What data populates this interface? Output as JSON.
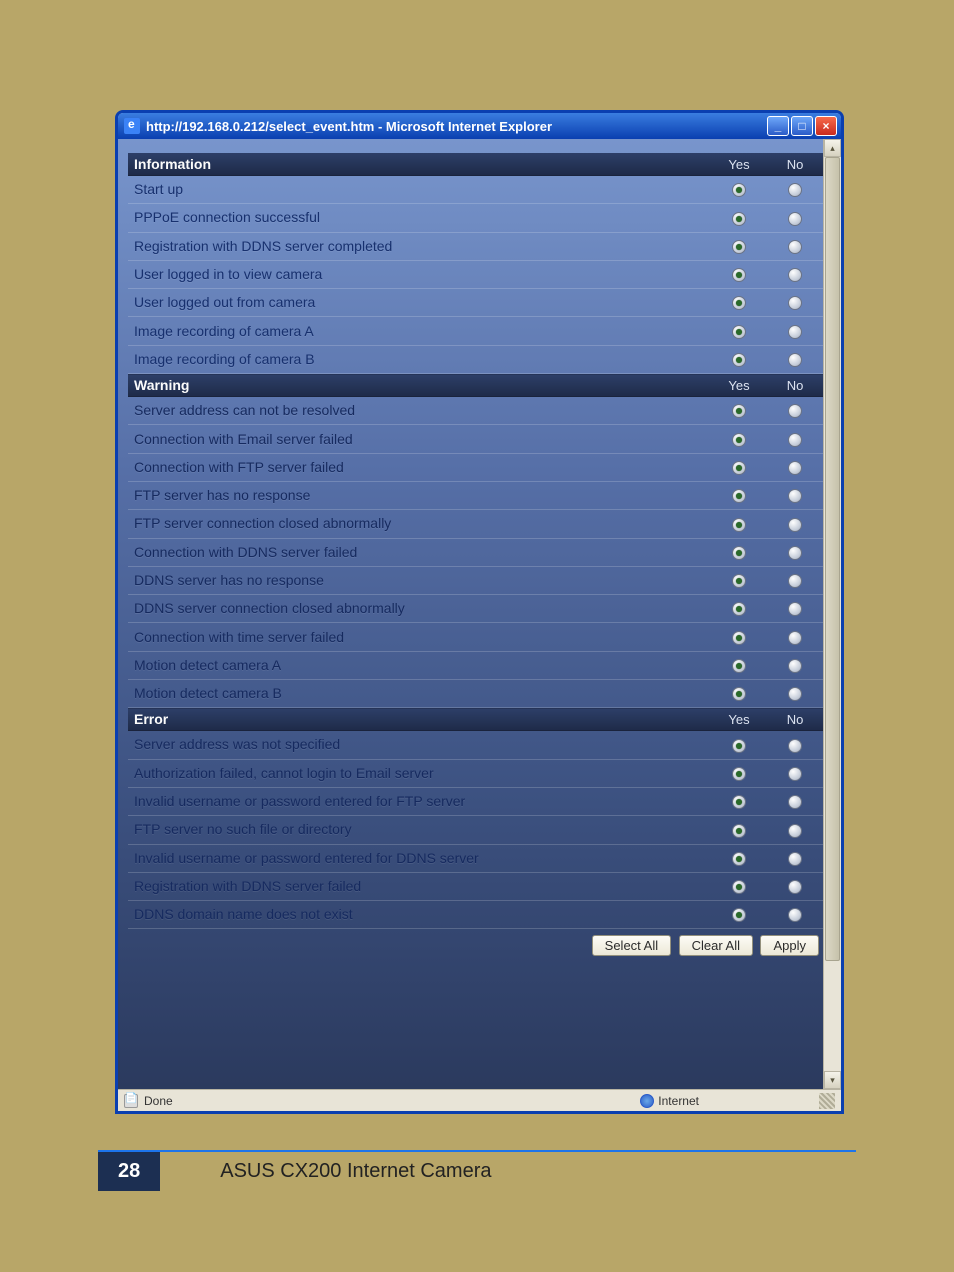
{
  "window": {
    "title": "http://192.168.0.212/select_event.htm - Microsoft Internet Explorer"
  },
  "columns": {
    "yes": "Yes",
    "no": "No"
  },
  "sections": [
    {
      "title": "Information",
      "rows": [
        {
          "label": "Start up",
          "selected": "yes"
        },
        {
          "label": "PPPoE connection successful",
          "selected": "yes"
        },
        {
          "label": "Registration with DDNS server completed",
          "selected": "yes"
        },
        {
          "label": "User logged in to view camera",
          "selected": "yes"
        },
        {
          "label": "User logged out from camera",
          "selected": "yes"
        },
        {
          "label": "Image recording of camera A",
          "selected": "yes"
        },
        {
          "label": "Image recording of camera B",
          "selected": "yes"
        }
      ]
    },
    {
      "title": "Warning",
      "rows": [
        {
          "label": "Server address can not be resolved",
          "selected": "yes"
        },
        {
          "label": "Connection with Email server failed",
          "selected": "yes"
        },
        {
          "label": "Connection with FTP server failed",
          "selected": "yes"
        },
        {
          "label": "FTP server has no response",
          "selected": "yes"
        },
        {
          "label": "FTP server connection closed abnormally",
          "selected": "yes"
        },
        {
          "label": "Connection with DDNS server failed",
          "selected": "yes"
        },
        {
          "label": "DDNS server has no response",
          "selected": "yes"
        },
        {
          "label": "DDNS server connection closed abnormally",
          "selected": "yes"
        },
        {
          "label": "Connection with time server failed",
          "selected": "yes"
        },
        {
          "label": "Motion detect camera A",
          "selected": "yes"
        },
        {
          "label": "Motion detect camera B",
          "selected": "yes"
        }
      ]
    },
    {
      "title": "Error",
      "rows": [
        {
          "label": "Server address was not specified",
          "selected": "yes"
        },
        {
          "label": "Authorization failed, cannot login to Email server",
          "selected": "yes"
        },
        {
          "label": "Invalid username or password entered for FTP server",
          "selected": "yes"
        },
        {
          "label": "FTP server no such file or directory",
          "selected": "yes"
        },
        {
          "label": "Invalid username or password entered for DDNS server",
          "selected": "yes"
        },
        {
          "label": "Registration with DDNS server failed",
          "selected": "yes"
        },
        {
          "label": "DDNS domain name does not exist",
          "selected": "yes"
        }
      ]
    }
  ],
  "buttons": {
    "select_all": "Select All",
    "clear_all": "Clear All",
    "apply": "Apply"
  },
  "status": {
    "done": "Done",
    "zone": "Internet"
  },
  "footer": {
    "page_number": "28",
    "product": "ASUS CX200 Internet Camera"
  }
}
